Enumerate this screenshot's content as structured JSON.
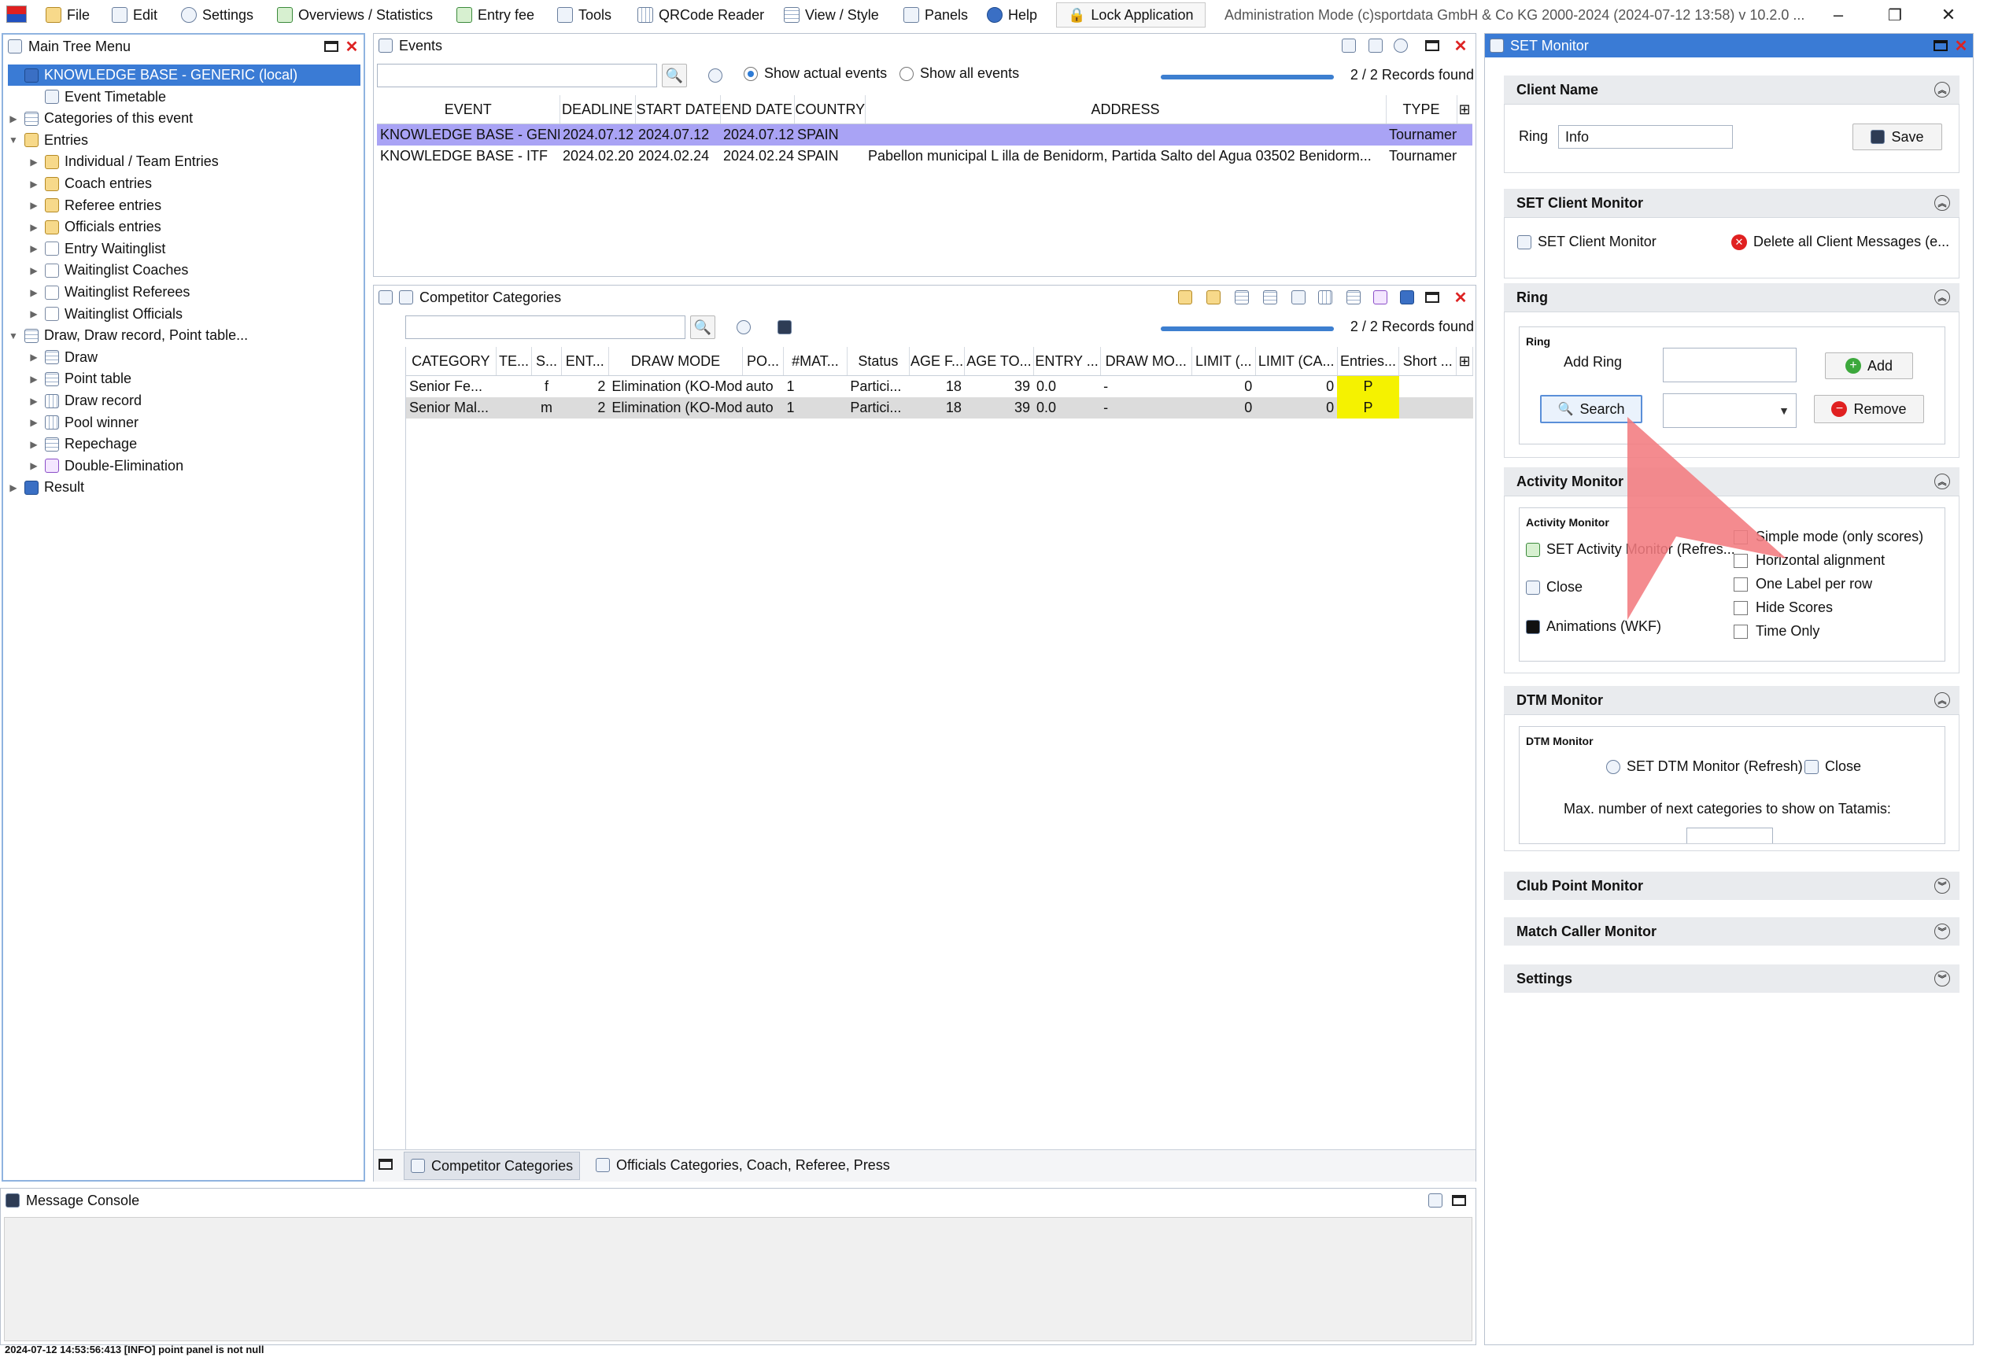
{
  "menubar": {
    "items": [
      {
        "label": "File",
        "icon": "folder-icon"
      },
      {
        "label": "Edit",
        "icon": "edit-icon"
      },
      {
        "label": "Settings",
        "icon": "gear-icon"
      },
      {
        "label": "Overviews / Statistics",
        "icon": "overview-icon"
      },
      {
        "label": "Entry fee",
        "icon": "money-icon"
      },
      {
        "label": "Tools",
        "icon": "wrench-icon"
      },
      {
        "label": "QRCode Reader",
        "icon": "qrcode-icon"
      },
      {
        "label": "View / Style",
        "icon": "view-icon"
      },
      {
        "label": "Panels",
        "icon": "panels-icon"
      },
      {
        "label": "Help",
        "icon": "help-icon"
      }
    ],
    "lock_label": "Lock Application",
    "status_text": "Administration Mode (c)sportdata GmbH & Co KG 2000-2024 (2024-07-12 13:58)  v 10.2.0 ...",
    "minimize": "–",
    "maximize": "❐",
    "close": "✕"
  },
  "main_tree": {
    "title": "Main Tree Menu",
    "items": [
      {
        "label": "KNOWLEDGE BASE - GENERIC (local)",
        "level": 0,
        "expander": "",
        "icon": "database-icon",
        "selected": true
      },
      {
        "label": "Event Timetable",
        "level": 1,
        "expander": "",
        "icon": "clock-icon"
      },
      {
        "label": "Categories of this event",
        "level": 0,
        "expander": "▶",
        "icon": "list-icon"
      },
      {
        "label": "Entries",
        "level": 0,
        "expander": "▼",
        "icon": "folder-icon"
      },
      {
        "label": "Individual / Team Entries",
        "level": 1,
        "expander": "▶",
        "icon": "folder-icon"
      },
      {
        "label": "Coach entries",
        "level": 1,
        "expander": "▶",
        "icon": "folder-icon"
      },
      {
        "label": "Referee entries",
        "level": 1,
        "expander": "▶",
        "icon": "folder-icon"
      },
      {
        "label": "Officials entries",
        "level": 1,
        "expander": "▶",
        "icon": "folder-icon"
      },
      {
        "label": "Entry Waitinglist",
        "level": 1,
        "expander": "▶",
        "icon": "chart-icon"
      },
      {
        "label": "Waitinglist Coaches",
        "level": 1,
        "expander": "▶",
        "icon": "chart-icon"
      },
      {
        "label": "Waitinglist Referees",
        "level": 1,
        "expander": "▶",
        "icon": "chart-icon"
      },
      {
        "label": "Waitinglist Officials",
        "level": 1,
        "expander": "▶",
        "icon": "chart-icon"
      },
      {
        "label": "Draw, Draw record, Point table...",
        "level": 0,
        "expander": "▼",
        "icon": "draw-icon"
      },
      {
        "label": "Draw",
        "level": 1,
        "expander": "▶",
        "icon": "draw-icon"
      },
      {
        "label": "Point table",
        "level": 1,
        "expander": "▶",
        "icon": "list-icon"
      },
      {
        "label": "Draw record",
        "level": 1,
        "expander": "▶",
        "icon": "table-icon"
      },
      {
        "label": "Pool winner",
        "level": 1,
        "expander": "▶",
        "icon": "grid-icon"
      },
      {
        "label": "Repechage",
        "level": 1,
        "expander": "▶",
        "icon": "repechage-icon"
      },
      {
        "label": "Double-Elimination",
        "level": 1,
        "expander": "▶",
        "icon": "double-elim-icon"
      },
      {
        "label": "Result",
        "level": 0,
        "expander": "▶",
        "icon": "result-icon"
      }
    ]
  },
  "events": {
    "title": "Events",
    "search_value": "",
    "radio_actual": "Show actual events",
    "radio_all": "Show all events",
    "progress": 1.0,
    "records": "2 / 2 Records found",
    "columns": [
      "EVENT",
      "DEADLINE",
      "START DATE",
      "END DATE",
      "COUNTRY",
      "ADDRESS",
      "TYPE"
    ],
    "rows": [
      [
        "KNOWLEDGE BASE - GENE...",
        "2024.07.12",
        "2024.07.12",
        "2024.07.12",
        "SPAIN",
        "",
        "Tournament"
      ],
      [
        "KNOWLEDGE BASE - ITF",
        "2024.02.20",
        "2024.02.24",
        "2024.02.24",
        "SPAIN",
        "Pabellon municipal L illa de Benidorm, Partida Salto del Agua 03502 Benidorm...",
        "Tournament"
      ]
    ]
  },
  "categories": {
    "title": "Competitor Categories",
    "search_value": "",
    "progress": 1.0,
    "records": "2 / 2 Records found",
    "columns": [
      "CATEGORY",
      "TE...",
      "S...",
      "ENT...",
      "DRAW MODE",
      "PO...",
      "#MAT...",
      "Status",
      "AGE F...",
      "AGE TO...",
      "ENTRY ...",
      "DRAW MO...",
      "LIMIT (...",
      "LIMIT (CA...",
      "Entries...",
      "Short ..."
    ],
    "rows": [
      [
        "Senior Fe...",
        "",
        "f",
        "2",
        "Elimination (KO-Mode)...",
        "auto",
        "1",
        "Partici...",
        "18",
        "39",
        "0.0",
        "-",
        "0",
        "0",
        "P",
        ""
      ],
      [
        "Senior Mal...",
        "",
        "m",
        "2",
        "Elimination (KO-Mode)...",
        "auto",
        "1",
        "Partici...",
        "18",
        "39",
        "0.0",
        "-",
        "0",
        "0",
        "P",
        ""
      ]
    ],
    "tabs": [
      "Competitor Categories",
      "Officials Categories, Coach, Referee, Press"
    ]
  },
  "console": {
    "title": "Message Console",
    "status_line": "2024-07-12 14:53:56:413 [INFO] point panel is not null"
  },
  "set_monitor": {
    "title": "SET Monitor",
    "client_name": {
      "header": "Client Name",
      "ring_label": "Ring",
      "ring_value": "Info",
      "save": "Save"
    },
    "client_monitor": {
      "header": "SET Client Monitor",
      "open_label": "SET Client Monitor",
      "delete_label": "Delete all Client Messages (e..."
    },
    "ring": {
      "header": "Ring",
      "group_label": "Ring",
      "add_ring_label": "Add Ring",
      "add_ring_value": "",
      "add": "Add",
      "search": "Search",
      "select_value": "",
      "remove": "Remove"
    },
    "activity": {
      "header": "Activity Monitor",
      "group_label": "Activity Monitor",
      "open_label": "SET Activity Monitor (Refres...",
      "close_label": "Close",
      "animations_label": "Animations (WKF)",
      "options": [
        "Simple mode (only scores)",
        "Horizontal alignment",
        "One Label per row",
        "Hide Scores",
        "Time Only"
      ]
    },
    "dtm": {
      "header": "DTM Monitor",
      "group_label": "DTM Monitor",
      "open_label": "SET DTM Monitor (Refresh)",
      "close_label": "Close",
      "max_label": "Max. number of next categories to show on Tatamis:"
    },
    "collapsed_sections": [
      "Club Point Monitor",
      "Match Caller Monitor",
      "Settings"
    ]
  },
  "colors": {
    "selection_blue": "#a9a3f5",
    "selection_grey": "#dcdcdc",
    "tree_selected": "#3a7bd5",
    "highlight_yellow": "#f5f200",
    "pointer_red": "#f27b80"
  }
}
